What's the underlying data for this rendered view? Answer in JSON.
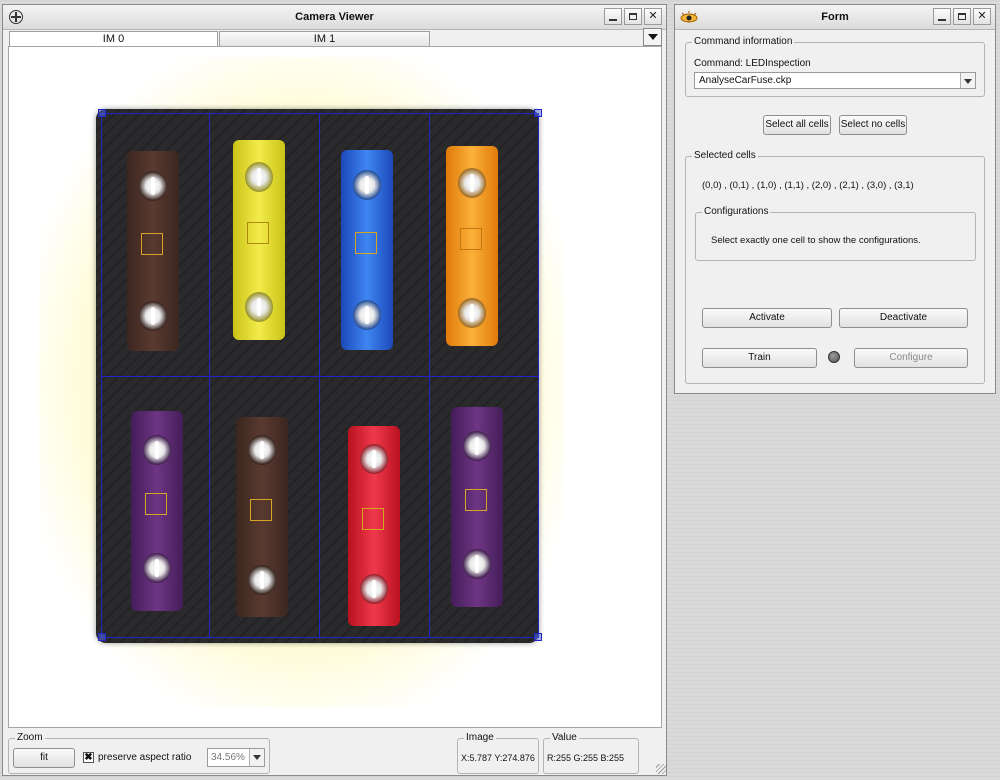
{
  "camera_viewer": {
    "title": "Camera Viewer",
    "tabs": [
      {
        "label": "IM 0",
        "active": true
      },
      {
        "label": "IM 1",
        "active": false
      }
    ],
    "zoom": {
      "group_label": "Zoom",
      "fit_label": "fit",
      "preserve_label": "preserve aspect ratio",
      "preserve_checked": true,
      "checkbox_mark": "✖",
      "percent": "34.56%"
    },
    "image": {
      "group_label": "Image",
      "coords": "X:5.787  Y:274.876"
    },
    "value": {
      "group_label": "Value",
      "rgb": "R:255 G:255 B:255"
    }
  },
  "form": {
    "title": "Form",
    "command_info": {
      "group_label": "Command information",
      "command_text": "Command: LEDInspection",
      "file": "AnalyseCarFuse.ckp"
    },
    "select_all_label": "Select all cells",
    "select_none_label": "Select no cells",
    "selected_cells": {
      "group_label": "Selected cells",
      "cells_text": "(0,0) , (0,1) , (1,0) , (1,1) , (2,0) , (2,1) , (3,0) , (3,1)"
    },
    "configurations": {
      "group_label": "Configurations",
      "message": "Select exactly one cell to show the configurations."
    },
    "activate_label": "Activate",
    "deactivate_label": "Deactivate",
    "train_label": "Train",
    "configure_label": "Configure"
  },
  "colors": {
    "fuse_brown": "#4a2e26",
    "fuse_yellow": "#e9e23a",
    "fuse_blue": "#2f6fe6",
    "fuse_orange": "#f59b1a",
    "fuse_purple": "#5a2a6e",
    "fuse_red": "#e0283a",
    "grid": "#1f25c8"
  },
  "icons": {
    "camera_app": "crosshair-icon",
    "form_app": "eye-icon",
    "tab_menu": "triangle-down-icon"
  }
}
